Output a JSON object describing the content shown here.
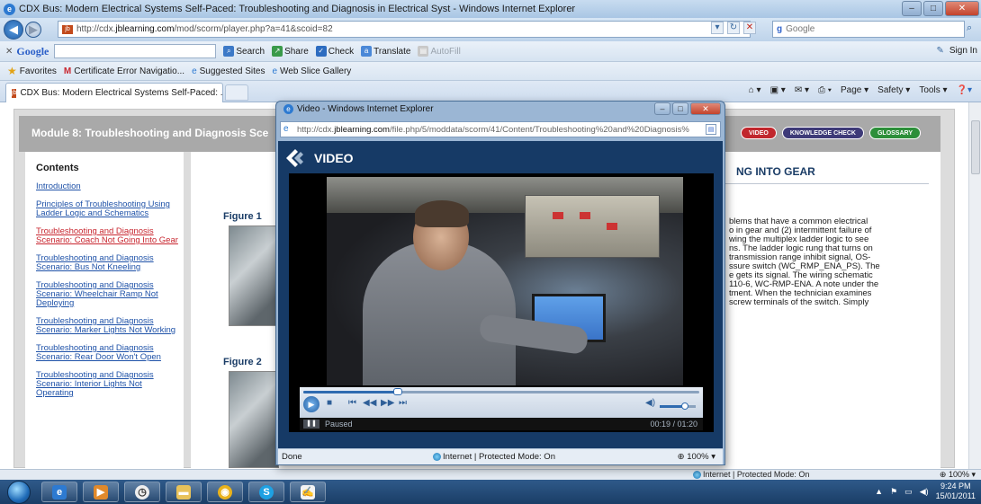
{
  "window": {
    "title": "CDX Bus: Modern Electrical Systems Self-Paced: Troubleshooting and Diagnosis in Electrical Syst - Windows Internet Explorer"
  },
  "address_bar": {
    "url_prefix": "http://cdx.",
    "url_domain": "jblearning.com",
    "url_suffix": "/mod/scorm/player.php?a=41&scoid=82",
    "search_placeholder": "Google"
  },
  "google_toolbar": {
    "logo": "Google",
    "items": [
      "Search",
      "Share",
      "Check",
      "Translate",
      "AutoFill"
    ],
    "signin": "Sign In"
  },
  "favorites_bar": {
    "favorites_label": "Favorites",
    "items": [
      "Certificate Error Navigatio...",
      "Suggested Sites",
      "Web Slice Gallery"
    ]
  },
  "tab": {
    "label": "CDX Bus: Modern Electrical Systems Self-Paced: ..."
  },
  "command_bar": {
    "items": [
      "Page",
      "Safety",
      "Tools"
    ]
  },
  "course": {
    "module_title": "Module 8: Troubleshooting and Diagnosis Sce",
    "nav_buttons": [
      "VIDEO",
      "KNOWLEDGE CHECK",
      "GLOSSARY"
    ],
    "contents_heading": "Contents",
    "toc": [
      "Introduction",
      "Principles of Troubleshooting Using Ladder Logic and Schematics",
      "Troubleshooting and Diagnosis Scenario: Coach Not Going Into Gear",
      "Troubleshooting and Diagnosis Scenario: Bus Not Kneeling",
      "Troubleshooting and Diagnosis Scenario: Wheelchair Ramp Not Deploying",
      "Troubleshooting and Diagnosis Scenario: Marker Lights Not Working",
      "Troubleshooting and Diagnosis Scenario: Rear Door Won't Open",
      "Troubleshooting and Diagnosis Scenario: Interior Lights Not Operating"
    ],
    "figure_1": "Figure 1",
    "figure_2": "Figure 2",
    "section_title": "NG INTO GEAR",
    "paragraph_lines": [
      "blems that have a common electrical",
      "o in gear and (2) intermittent failure of",
      "wing the multiplex ladder logic to see",
      "ns. The ladder logic rung that turns on",
      "transmission range inhibit signal, OS-",
      "ssure switch (WC_RMP_ENA_PS). The",
      "e gets its signal. The wiring schematic",
      "110-6, WC-RMP-ENA. A note under the",
      "tment. When the technician examines",
      "screw terminals of the switch. Simply"
    ]
  },
  "main_status": {
    "zone": "Internet | Protected Mode: On",
    "zoom": "100%"
  },
  "popup": {
    "title": "Video - Windows Internet Explorer",
    "url_prefix": "http://cdx.",
    "url_domain": "jblearning.com",
    "url_suffix": "/file.php/5/moddata/scorm/41/Content/Troubleshooting%20and%20Diagnosis%",
    "header": "VIDEO",
    "player_state": "Paused",
    "player_time": "00:19 / 01:20",
    "progress_fraction": 0.2375,
    "volume_fraction": 0.7,
    "status_done": "Done",
    "status_zone": "Internet | Protected Mode: On",
    "status_zoom": "100%"
  },
  "taskbar": {
    "time": "9:24 PM",
    "date": "15/01/2011"
  },
  "colors": {
    "video_bg": "#163a66",
    "toc_link": "#1f52a8",
    "toc_active": "#c8262f",
    "pill_video": "#c1272d",
    "pill_kc": "#3e3a78",
    "pill_glossary": "#2d8f3a"
  }
}
